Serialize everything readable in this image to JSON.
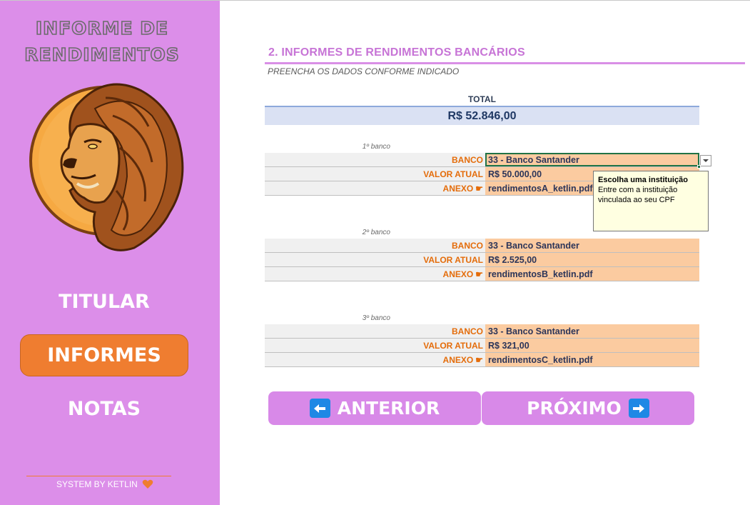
{
  "sidebar": {
    "title_line1": "INFORME DE",
    "title_line2": "RENDIMENTOS",
    "nav": {
      "titular": "TITULAR",
      "informes": "INFORMES",
      "notas": "NOTAS"
    },
    "footer": "SYSTEM BY KETLIN",
    "footer_icon": "heart-icon"
  },
  "main": {
    "section_title": "2. INFORMES DE RENDIMENTOS BANCÁRIOS",
    "subtitle": "PREENCHA OS DADOS CONFORME INDICADO",
    "total_label": "TOTAL",
    "total_value": "R$ 52.846,00",
    "labels": {
      "banco": "BANCO",
      "valor": "VALOR ATUAL",
      "anexo": "ANEXO"
    },
    "banks": [
      {
        "caption": "1º banco",
        "banco": "33 - Banco Santander",
        "valor": "R$ 50.000,00",
        "anexo": "rendimentosA_ketlin.pdf"
      },
      {
        "caption": "2º banco",
        "banco": "33 - Banco Santander",
        "valor": "R$ 2.525,00",
        "anexo": "rendimentosB_ketlin.pdf"
      },
      {
        "caption": "3º banco",
        "banco": "33 - Banco Santander",
        "valor": "R$ 321,00",
        "anexo": "rendimentosC_ketlin.pdf"
      }
    ],
    "tooltip": {
      "title": "Escolha uma instituição",
      "body": "Entre com a instituição vinculada ao seu CPF"
    },
    "buttons": {
      "prev": "ANTERIOR",
      "next": "PRÓXIMO"
    }
  },
  "colors": {
    "sidebar_bg": "#dc8ee9",
    "active_nav": "#ef7d30",
    "label_orange": "#e46c0a",
    "value_bg": "#fbcba0",
    "total_bg": "#dae1f3",
    "button_bg": "#d889e8",
    "arrow_blue": "#1e88e5"
  }
}
